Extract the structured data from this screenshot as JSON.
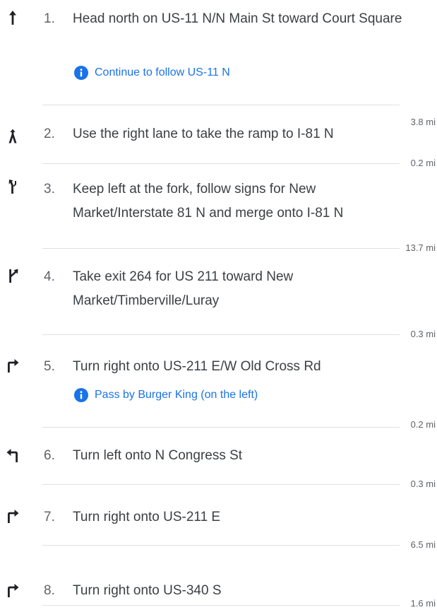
{
  "steps": [
    {
      "number": "1.",
      "instruction": "Head north on US-11 N/N Main St toward Court Square",
      "note": "Continue to follow US-11 N",
      "distance": "3.8 mi",
      "icon": "arrow-up-icon"
    },
    {
      "number": "2.",
      "instruction": "Use the right lane to take the ramp to I-81 N",
      "distance": "0.2 mi",
      "icon": "ramp-right-icon"
    },
    {
      "number": "3.",
      "instruction": "Keep left at the fork, follow signs for New Market/Interstate 81 N and merge onto I-81 N",
      "distance": "13.7 mi",
      "icon": "fork-left-icon"
    },
    {
      "number": "4.",
      "instruction": "Take exit 264 for US 211 toward New Market/Timberville/Luray",
      "distance": "0.3 mi",
      "icon": "exit-right-icon"
    },
    {
      "number": "5.",
      "instruction": "Turn right onto US-211 E/W Old Cross Rd",
      "note": "Pass by Burger King (on the left)",
      "distance": "0.2 mi",
      "icon": "turn-right-icon"
    },
    {
      "number": "6.",
      "instruction": "Turn left onto N Congress St",
      "distance": "0.3 mi",
      "icon": "turn-left-icon"
    },
    {
      "number": "7.",
      "instruction": "Turn right onto US-211 E",
      "distance": "6.5 mi",
      "icon": "turn-right-icon"
    },
    {
      "number": "8.",
      "instruction": "Turn right onto US-340 S",
      "distance": "1.6 mi",
      "icon": "turn-right-icon"
    }
  ],
  "colors": {
    "note_text": "#1a73e8",
    "info_icon": "#1a73e8",
    "maneuver_icon": "#202124",
    "divider": "#e0e0e0"
  }
}
